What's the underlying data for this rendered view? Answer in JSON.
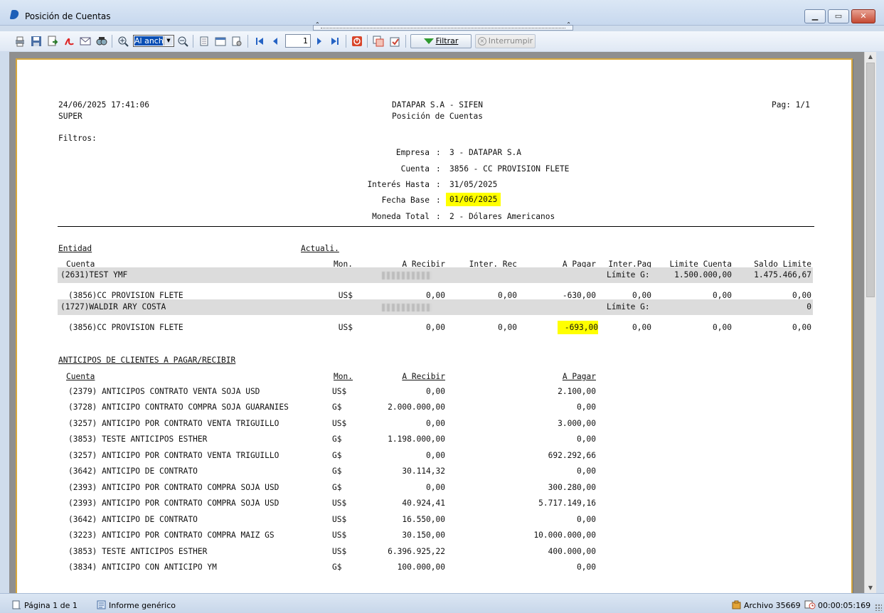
{
  "window": {
    "title": "Posición de Cuentas",
    "min": "▁",
    "max": "▭",
    "close": "✕"
  },
  "toolbar": {
    "zoom_value": "Al ancho",
    "page_number": "1",
    "filtrar_label": "Filtrar",
    "interrumpir_label": "Interrumpir",
    "icons": [
      "print-icon",
      "save-icon",
      "export-icon",
      "pdf-icon",
      "email-icon",
      "find-icon",
      "zoom-in-icon",
      "zoom-out-icon",
      "single-page-icon",
      "two-pages-icon",
      "page-setup-icon",
      "first-page-icon",
      "prev-page-icon",
      "next-page-icon",
      "last-page-icon",
      "stop-icon",
      "copy-report-icon",
      "refresh-icon"
    ]
  },
  "report": {
    "datetime": "24/06/2025 17:41:06",
    "user": "SUPER",
    "company_title": "DATAPAR S.A - SIFEN",
    "report_title": "Posición de Cuentas",
    "page": "Pag: 1/1",
    "filters_label": "Filtros:",
    "filters": [
      {
        "label": "Empresa",
        "value": "3 - DATAPAR S.A"
      },
      {
        "label": "Cuenta",
        "value": "3856 - CC PROVISION FLETE"
      },
      {
        "label": "Interés Hasta",
        "value": "31/05/2025"
      },
      {
        "label": "Fecha Base",
        "value": "01/06/2025"
      },
      {
        "label": "Moneda Total",
        "value": "2 - Dólares Americanos"
      }
    ],
    "sep": ":",
    "headers": {
      "entidad": "Entidad",
      "actuali": "Actuali.",
      "cuenta": "Cuenta",
      "mon": "Mon.",
      "a_recibir": "A Recibir",
      "inter_rec": "Inter. Rec",
      "a_pagar": "A Pagar",
      "inter_pag": "Inter.Pag",
      "limite_cuenta": "Limite Cuenta",
      "saldo_limite": "Saldo Limite"
    },
    "entities": [
      {
        "name": "(2631)TEST YMF",
        "limite_label": "Límite G:",
        "limite_cuenta": "1.500.000,00",
        "saldo_limite": "1.475.466,67",
        "row": {
          "cuenta": "(3856)CC PROVISION FLETE",
          "mon": "US$",
          "a_recibir": "0,00",
          "inter_rec": "0,00",
          "a_pagar": "-630,00",
          "inter_pag": "0,00",
          "limite_cuenta": "0,00",
          "saldo_limite": "0,00"
        }
      },
      {
        "name": "(1727)WALDIR ARY COSTA",
        "limite_label": "Límite G:",
        "limite_cuenta": "",
        "saldo_limite": "0",
        "row": {
          "cuenta": "(3856)CC PROVISION FLETE",
          "mon": "US$",
          "a_recibir": "0,00",
          "inter_rec": "0,00",
          "a_pagar": "-693,00",
          "inter_pag": "0,00",
          "limite_cuenta": "0,00",
          "saldo_limite": "0,00"
        }
      }
    ],
    "anticipos_title": "ANTICIPOS DE CLIENTES A PAGAR/RECIBIR",
    "anticipos_headers": {
      "cuenta": "Cuenta",
      "mon": "Mon.",
      "a_recibir": "A Recibir",
      "a_pagar": "A Pagar"
    },
    "anticipos": [
      {
        "cuenta": "(2379) ANTICIPOS CONTRATO VENTA SOJA USD",
        "mon": "US$",
        "a_recibir": "0,00",
        "a_pagar": "2.100,00"
      },
      {
        "cuenta": "(3728) ANTICIPO CONTRATO COMPRA SOJA GUARANIES",
        "mon": "G$",
        "a_recibir": "2.000.000,00",
        "a_pagar": "0,00"
      },
      {
        "cuenta": "(3257) ANTICIPO POR CONTRATO VENTA TRIGUILLO",
        "mon": "US$",
        "a_recibir": "0,00",
        "a_pagar": "3.000,00"
      },
      {
        "cuenta": "(3853) TESTE ANTICIPOS ESTHER",
        "mon": "G$",
        "a_recibir": "1.198.000,00",
        "a_pagar": "0,00"
      },
      {
        "cuenta": "(3257) ANTICIPO POR CONTRATO VENTA TRIGUILLO",
        "mon": "G$",
        "a_recibir": "0,00",
        "a_pagar": "692.292,66"
      },
      {
        "cuenta": "(3642) ANTICIPO DE CONTRATO",
        "mon": "G$",
        "a_recibir": "30.114,32",
        "a_pagar": "0,00"
      },
      {
        "cuenta": "(2393) ANTICIPO POR CONTRATO COMPRA SOJA USD",
        "mon": "G$",
        "a_recibir": "0,00",
        "a_pagar": "300.280,00"
      },
      {
        "cuenta": "(2393) ANTICIPO POR CONTRATO COMPRA SOJA USD",
        "mon": "US$",
        "a_recibir": "40.924,41",
        "a_pagar": "5.717.149,16"
      },
      {
        "cuenta": "(3642) ANTICIPO DE CONTRATO",
        "mon": "US$",
        "a_recibir": "16.550,00",
        "a_pagar": "0,00"
      },
      {
        "cuenta": "(3223) ANTICIPO POR CONTRATO COMPRA MAIZ GS",
        "mon": "US$",
        "a_recibir": "30.150,00",
        "a_pagar": "10.000.000,00"
      },
      {
        "cuenta": "(3853) TESTE ANTICIPOS ESTHER",
        "mon": "US$",
        "a_recibir": "6.396.925,22",
        "a_pagar": "400.000,00"
      },
      {
        "cuenta": "(3834) ANTICIPO CON ANTICIPO YM",
        "mon": "G$",
        "a_recibir": "100.000,00",
        "a_pagar": "0,00"
      }
    ]
  },
  "status": {
    "pagina": "Página 1 de 1",
    "informe": "Informe genérico",
    "archivo": "Archivo 35669",
    "tiempo": "00:00:05:169"
  },
  "colors": {
    "highlight": "#ffff00",
    "page_border": "#d7a73d",
    "band": "#dcdcdc"
  }
}
